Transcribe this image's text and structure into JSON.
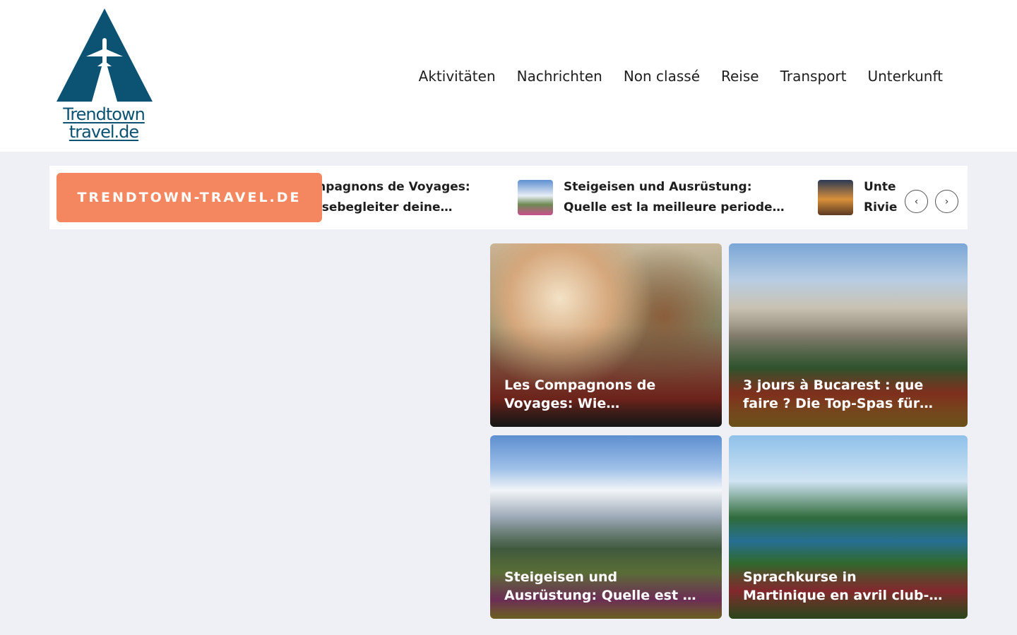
{
  "brand": {
    "line1": "Trendtown",
    "line2": "travel.de",
    "color": "#0c5273"
  },
  "nav": [
    "Aktivitäten",
    "Nachrichten",
    "Non classé",
    "Reise",
    "Transport",
    "Unterkunft"
  ],
  "ticker": {
    "label": "TRENDTOWN-TRAVEL.DE",
    "accent": "#f4875f",
    "items": [
      {
        "line1": "Les Compagnons de Voyages:",
        "line2": "Ihre Reisebegleiter deine…"
      },
      {
        "line1": "Steigeisen und Ausrüstung:",
        "line2": "Quelle est la meilleure periode…"
      },
      {
        "line1": "Unterkunft an der",
        "line2": "Riviera"
      }
    ],
    "prev_icon": "chevron-left-icon",
    "next_icon": "chevron-right-icon"
  },
  "cards": [
    {
      "line1": "Les Compagnons de",
      "line2": "Voyages: Wie…"
    },
    {
      "line1": "3 jours à Bucarest : que",
      "line2": "faire ? Die Top-Spas für…"
    },
    {
      "line1": "Steigeisen und",
      "line2": "Ausrüstung: Quelle est …"
    },
    {
      "line1": "Sprachkurse in",
      "line2": "Martinique en avril club-…"
    }
  ]
}
